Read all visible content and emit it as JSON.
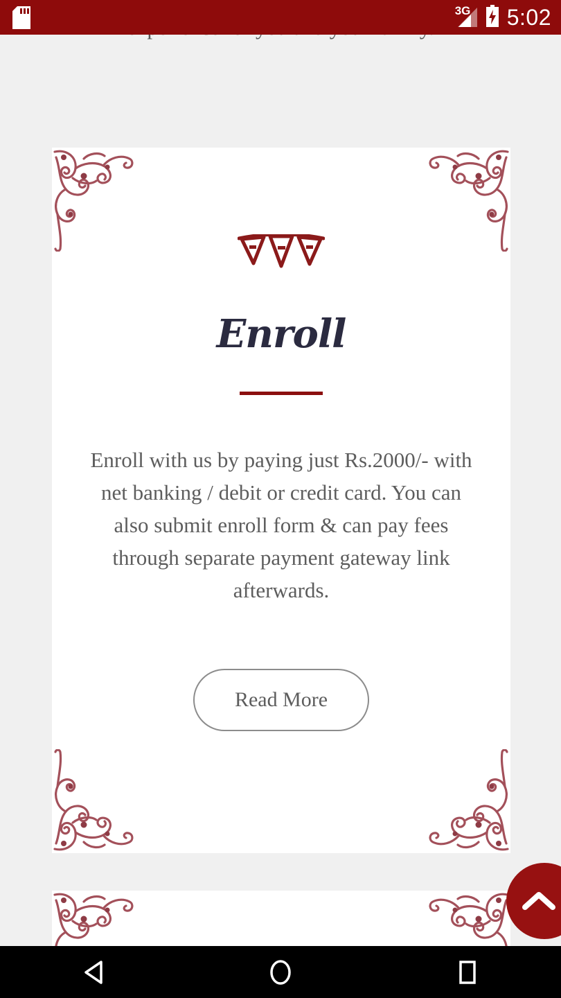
{
  "status_bar": {
    "background_color": "#8e0b0b",
    "sd_card_icon": "sd-card-icon",
    "network_label": "3G",
    "signal_icon": "signal-bars-icon",
    "battery_icon": "battery-charging-icon",
    "clock": "5:02"
  },
  "page": {
    "background_color": "#f0f0f0",
    "intro_paragraph": "experience for you and your family."
  },
  "card_enroll": {
    "background_color": "#ffffff",
    "ornament_icon": "filigree-corner-ornament-icon",
    "ornament_color": "#a04a52",
    "bunting_icon": "bunting-flags-icon",
    "bunting_color": "#8b1a1a",
    "title": "Enroll",
    "title_color": "#2b2b40",
    "rule_color": "#8b0f0f",
    "body": "Enroll with us by paying just Rs.2000/- with net banking / debit or credit card. You can also submit enroll form & can pay fees through separate payment gateway link afterwards.",
    "read_more_label": "Read More"
  },
  "card_next": {
    "background_color": "#ffffff",
    "ornament_icon": "filigree-corner-ornament-icon"
  },
  "scroll_top_fab": {
    "icon": "chevron-up-icon",
    "background_color": "#971111",
    "icon_color": "#ffffff"
  },
  "nav_bar": {
    "background_color": "#000000",
    "back_icon": "back-triangle-icon",
    "home_icon": "home-circle-icon",
    "recents_icon": "recents-square-icon"
  }
}
